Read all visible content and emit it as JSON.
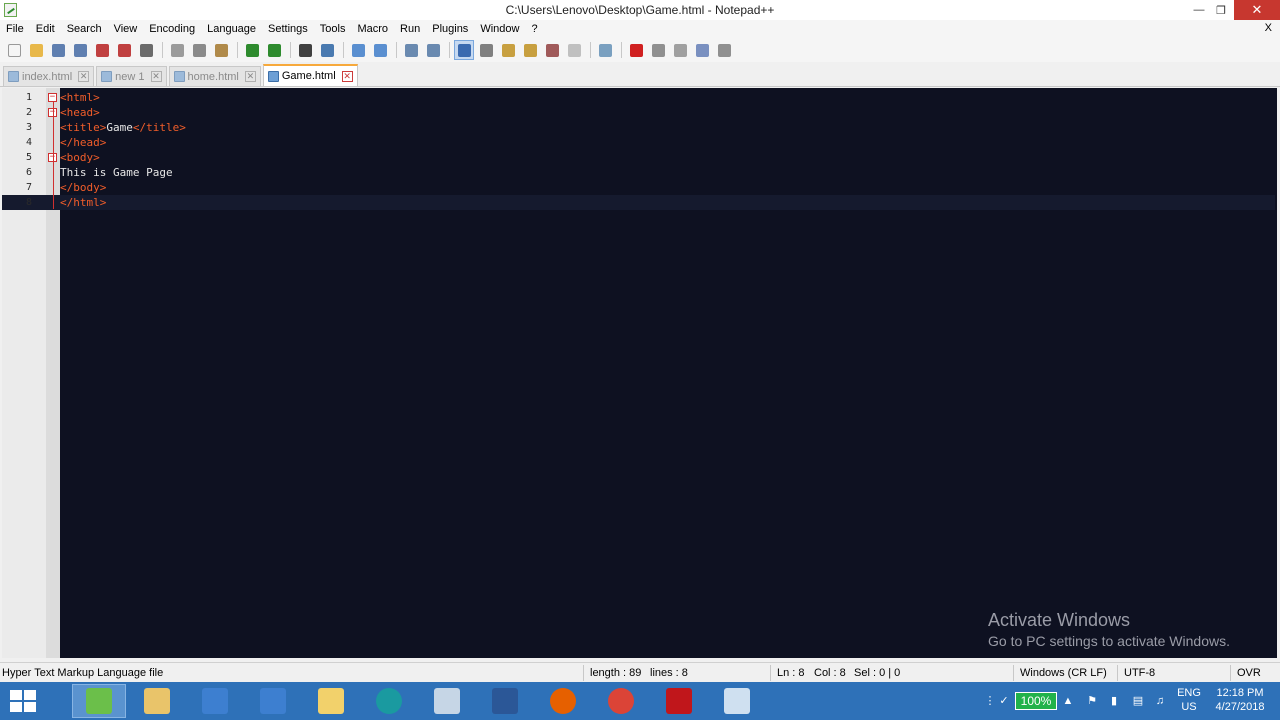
{
  "window": {
    "title": "C:\\Users\\Lenovo\\Desktop\\Game.html - Notepad++"
  },
  "menu": [
    "File",
    "Edit",
    "Search",
    "View",
    "Encoding",
    "Language",
    "Settings",
    "Tools",
    "Macro",
    "Run",
    "Plugins",
    "Window",
    "?"
  ],
  "menu_close": "X",
  "toolbar_icons": [
    "new-file-icon",
    "open-file-icon",
    "save-icon",
    "save-all-icon",
    "close-icon",
    "close-all-icon",
    "print-icon",
    "cut-icon",
    "copy-icon",
    "paste-icon",
    "undo-icon",
    "redo-icon",
    "find-icon",
    "replace-icon",
    "zoom-in-icon",
    "zoom-out-icon",
    "sync-vertical-icon",
    "sync-horizontal-icon",
    "word-wrap-icon",
    "show-all-chars-icon",
    "indent-guide-icon",
    "document-map-icon",
    "function-list-icon",
    "folder-workspace-icon",
    "monitoring-icon",
    "record-macro-icon",
    "stop-record-icon",
    "play-macro-icon",
    "run-macro-multiple-icon",
    "save-macro-icon"
  ],
  "tabs": [
    {
      "label": "index.html",
      "active": false
    },
    {
      "label": "new 1",
      "active": false
    },
    {
      "label": "home.html",
      "active": false
    },
    {
      "label": "Game.html",
      "active": true
    }
  ],
  "editor": {
    "lines": [
      {
        "num": "1",
        "parts": [
          {
            "t": "tag",
            "v": "<html>"
          }
        ],
        "fold": "minus"
      },
      {
        "num": "2",
        "parts": [
          {
            "t": "tag",
            "v": "<head>"
          }
        ],
        "fold": "minus"
      },
      {
        "num": "3",
        "parts": [
          {
            "t": "tag",
            "v": "<title>"
          },
          {
            "t": "txt",
            "v": "Game"
          },
          {
            "t": "tag",
            "v": "</title>"
          }
        ]
      },
      {
        "num": "4",
        "parts": [
          {
            "t": "tag",
            "v": "</head>"
          }
        ]
      },
      {
        "num": "5",
        "parts": [
          {
            "t": "tag",
            "v": "<body>"
          }
        ],
        "fold": "minus"
      },
      {
        "num": "6",
        "parts": [
          {
            "t": "txt",
            "v": "This is Game Page"
          }
        ]
      },
      {
        "num": "7",
        "parts": [
          {
            "t": "tag",
            "v": "</body>"
          }
        ]
      },
      {
        "num": "8",
        "parts": [
          {
            "t": "tag",
            "v": "</html>"
          }
        ],
        "current": true
      }
    ]
  },
  "watermark": {
    "line1": "Activate Windows",
    "line2": "Go to PC settings to activate Windows."
  },
  "status": {
    "file_type": "Hyper Text Markup Language file",
    "length": "length : 89",
    "lines": "lines : 8",
    "ln": "Ln : 8",
    "col": "Col : 8",
    "sel": "Sel : 0 | 0",
    "eol": "Windows (CR LF)",
    "encoding": "UTF-8",
    "mode": "OVR"
  },
  "taskbar": {
    "apps": [
      "notepadpp-icon",
      "file-explorer-icon",
      "document-icon",
      "document-icon",
      "folder-icon",
      "arduino-icon",
      "paint-icon",
      "word-icon",
      "firefox-icon",
      "chrome-icon",
      "acrobat-icon",
      "screen-recorder-icon"
    ],
    "battery": "100%",
    "lang_line1": "ENG",
    "lang_line2": "US",
    "time": "12:18 PM",
    "date": "4/27/2018"
  },
  "colors": {
    "editor_bg": "#0e1121",
    "tag": "#f05d2a",
    "text": "#e6e6e6",
    "taskbar": "#2e71b8"
  }
}
